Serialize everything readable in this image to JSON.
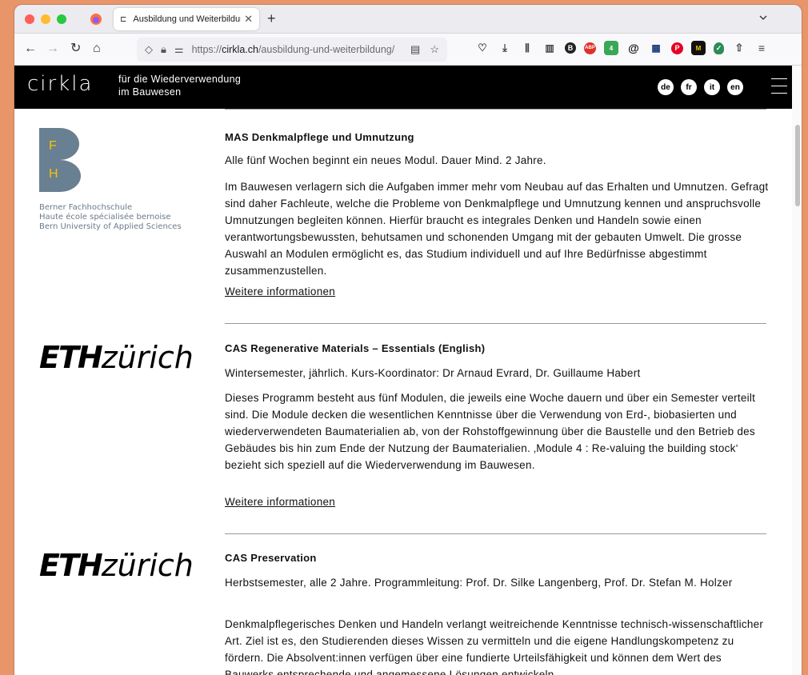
{
  "browser": {
    "tab_title": "Ausbildung und Weiterbildung –",
    "tab_favicon": "⊏",
    "new_tab": "+",
    "url_scheme": "https://",
    "url_host": "cirkla.ch",
    "url_path": "/ausbildung-und-weiterbildung/"
  },
  "site": {
    "logo": "cirkla",
    "tagline_line1": "für die Wiederverwendung",
    "tagline_line2": "im Bauwesen",
    "languages": [
      "de",
      "fr",
      "it",
      "en"
    ]
  },
  "entries": [
    {
      "logo_type": "bfh",
      "logo_letter1": "F",
      "logo_letter2": "H",
      "logo_caption": [
        "Berner Fachhochschule",
        "Haute école spécialisée bernoise",
        "Bern University of Applied Sciences"
      ],
      "title": "MAS Denkmalpflege und Umnutzung",
      "subtitle": "Alle fünf Wochen beginnt ein neues Modul. Dauer Mind. 2 Jahre.",
      "description": "Im Bauwesen verlagern sich die Aufgaben immer mehr vom Neubau auf das Erhalten und Umnutzen. Gefragt sind daher Fachleute, welche die Probleme von Denkmalpflege und Umnutzung kennen und anspruchsvolle Umnutzungen begleiten können. Hierfür braucht es integrales Denken und Handeln sowie einen verantwortungsbewussten, behutsamen und schonenden Umgang mit der gebauten Umwelt. Die grosse Auswahl an Modulen ermöglicht es, das Studium individuell und auf Ihre Bedürfnisse abgestimmt zusammenzustellen.",
      "link": "Weitere informationen"
    },
    {
      "logo_type": "eth",
      "logo_bold": "ETH",
      "logo_light": "zürich",
      "title": "CAS Regenerative Materials – Essentials (English)",
      "subtitle": "Wintersemester, jährlich. Kurs-Koordinator: Dr Arnaud Evrard, Dr. Guillaume Habert",
      "description": "Dieses Programm besteht aus fünf Modulen, die jeweils eine Woche dauern und über ein Semester verteilt sind. Die Module decken die wesentlichen Kenntnisse über die Verwendung von Erd-, biobasierten und wiederverwendeten Baumaterialien ab, von der Rohstoffgewinnung über die Baustelle und den Betrieb des Gebäudes bis hin zum Ende der Nutzung der Baumaterialien. ‚Module 4 : Re-valuing the building stock‘ bezieht sich speziell auf die Wiederverwendung im Bauwesen.",
      "link": "Weitere informationen"
    },
    {
      "logo_type": "eth",
      "logo_bold": "ETH",
      "logo_light": "zürich",
      "title": "CAS Preservation",
      "subtitle": "Herbstsemester, alle 2 Jahre. Programmleitung: Prof. Dr. Silke Langenberg, Prof. Dr. Stefan M. Holzer",
      "description": "Denkmalpflegerisches Denken und Handeln verlangt weitreichende Kenntnisse technisch-wissenschaftlicher Art. Ziel ist es, den Studierenden dieses Wissen zu vermitteln und die eigene Handlungskompetenz zu fördern. Die Absolvent:innen verfügen über eine fundierte Urteilsfähigkeit und können dem Wert des Bauwerks entsprechende und angemessene Lösungen entwickeln."
    }
  ],
  "colors": {
    "bfh_logo": "#697f92",
    "bfh_letters": "#f5c400",
    "header_bg": "#000000",
    "desktop_bg": "#e8956a"
  }
}
